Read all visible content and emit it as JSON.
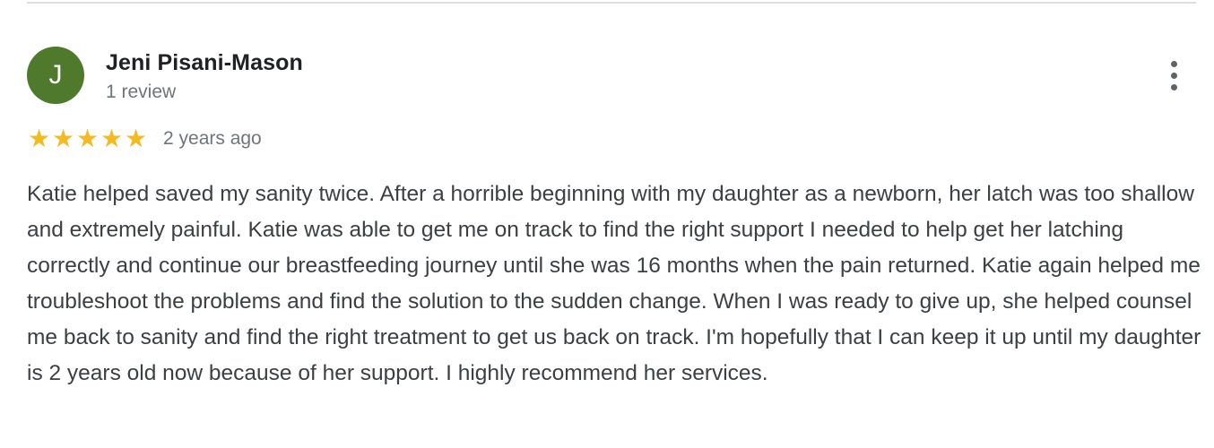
{
  "review": {
    "reviewer": {
      "avatar_letter": "J",
      "avatar_color": "#4f7a2c",
      "name": "Jeni Pisani-Mason",
      "review_count": "1 review"
    },
    "rating": {
      "stars": 5,
      "max_stars": 5,
      "star_color": "#f5b921"
    },
    "date": "2 years ago",
    "text": "Katie helped saved my sanity twice. After a horrible beginning with my daughter as a newborn, her latch was too shallow and extremely painful. Katie was able to get me on track to find the right support I needed to help get her latching correctly and continue our breastfeeding journey until she was 16 months when the pain returned. Katie again helped me troubleshoot the problems and find the solution to the sudden change. When I was ready to give up, she helped counsel me back to sanity and find the right treatment to get us back on track. I'm hopefully that I can keep it up until my daughter is 2 years old now because of her support. I highly recommend her services.",
    "more_icon": "more-vert-icon"
  }
}
